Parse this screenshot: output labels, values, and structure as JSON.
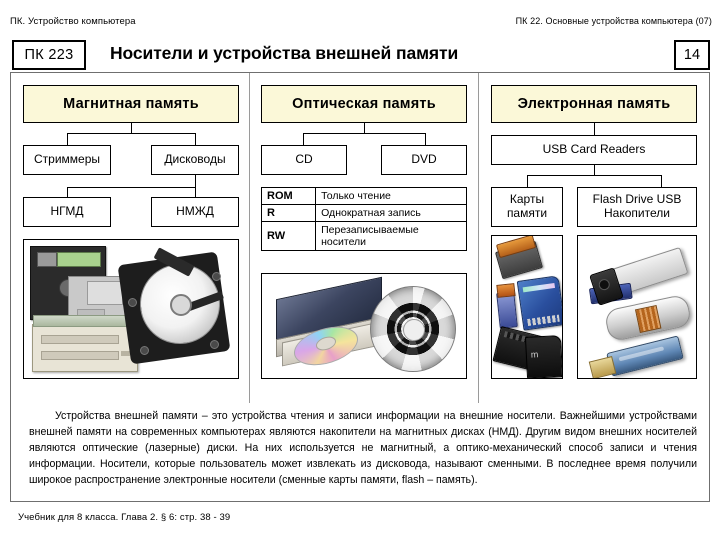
{
  "header": {
    "left_label": "ПК. Устройство  компьютера",
    "right_label": "ПК 22. Основные устройства компьютера (07)"
  },
  "title_row": {
    "code": "ПК 223",
    "title": "Носители и устройства внешней памяти",
    "page_number": "14"
  },
  "columns": [
    {
      "heading": "Магнитная  память",
      "children": [
        {
          "label": "Стриммеры"
        },
        {
          "label": "Дисководы",
          "children": [
            {
              "label": "НГМД"
            },
            {
              "label": "НМЖД"
            }
          ]
        }
      ]
    },
    {
      "heading": "Оптическая  память",
      "children": [
        {
          "label": "CD"
        },
        {
          "label": "DVD"
        }
      ]
    },
    {
      "heading": "Электронная память",
      "children": [
        {
          "label": "USB Card Readers",
          "children": [
            {
              "label": "Карты\nпамяти"
            },
            {
              "label": "Flash Drive USB\nНакопители"
            }
          ]
        }
      ]
    }
  ],
  "boxes": {
    "magnetic_heading": "Магнитная  память",
    "optical_heading": "Оптическая  память",
    "electronic_heading": "Электронная память",
    "streamers": "Стриммеры",
    "drives": "Дисководы",
    "ngmd": "НГМД",
    "nmzhd": "НМЖД",
    "cd": "CD",
    "dvd": "DVD",
    "usb_card_readers": "USB Card Readers",
    "memory_cards_line1": "Карты",
    "memory_cards_line2": "памяти",
    "flash_line1": "Flash Drive USB",
    "flash_line2": "Накопители"
  },
  "optical_table": {
    "rows": [
      {
        "key": "ROM",
        "value": "Только  чтение"
      },
      {
        "key": "R",
        "value": "Однократная  запись"
      },
      {
        "key": "RW",
        "value": "Перезаписываемые\nносители"
      }
    ]
  },
  "body_text": "Устройства  внешней  памяти – это устройства чтения и записи информации на внешние носители. Важнейшими устройствами внешней памяти на современных компьютерах являются накопители на магнитных дисках (НМД). Другим видом  внешних  носителей  являются  оптические  (лазерные)  диски.  На  них  используется  не  магнитный,  а  оптико-механический  способ  записи и чтения информации. Носители,  которые  пользователь  может  извлекать  из  дисковода, называют сменными. В последнее время получили широкое распространение электронные носители (сменные карты памяти, flash – память).",
  "footer": "Учебник для  8 класса.  Глава 2.  § 6:  стр. 38 - 39",
  "colors": {
    "heading_fill": "#fbf8d8",
    "border": "#000000",
    "frame_border": "#6f6f6f",
    "page_background": "#ffffff"
  },
  "artwork": {
    "magnetic_pane": "floppy-disks-and-hard-disk-photo",
    "optical_pane": "cd-drive-and-disc-photo",
    "cards_pane": "memory-cards-photo",
    "flash_pane": "usb-flash-drives-photo"
  }
}
